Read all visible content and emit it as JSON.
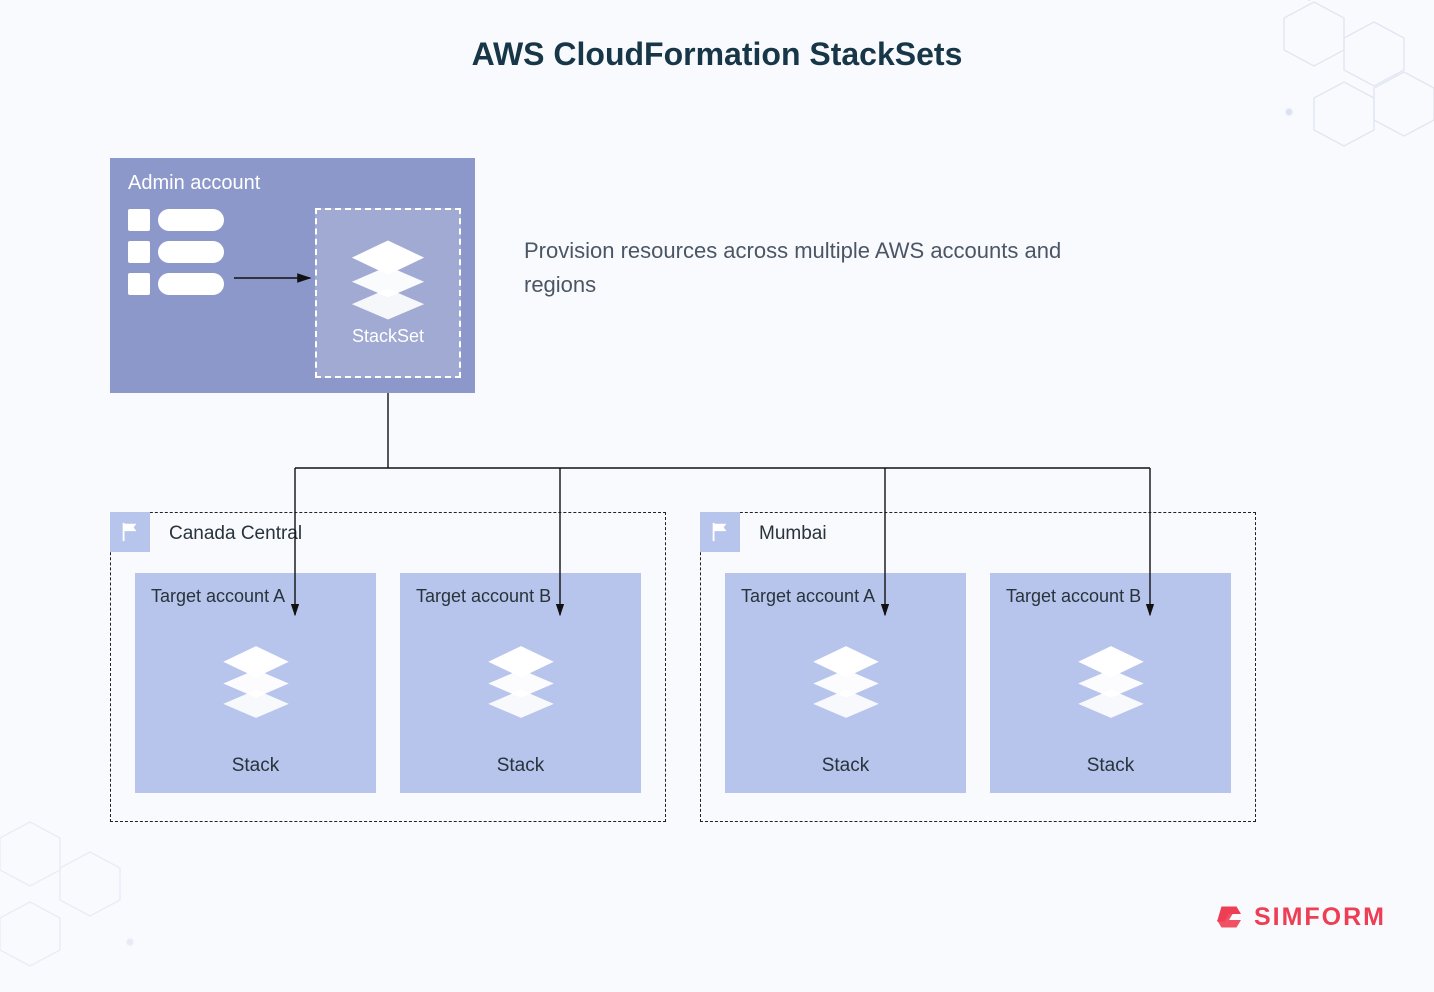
{
  "title": "AWS CloudFormation StackSets",
  "admin": {
    "title": "Admin account",
    "stackset_label": "StackSet"
  },
  "description": "Provision resources across multiple AWS accounts and regions",
  "regions": [
    {
      "name": "Canada Central",
      "targets": [
        {
          "label": "Target account A",
          "stack": "Stack"
        },
        {
          "label": "Target account B",
          "stack": "Stack"
        }
      ]
    },
    {
      "name": "Mumbai",
      "targets": [
        {
          "label": "Target account A",
          "stack": "Stack"
        },
        {
          "label": "Target account B",
          "stack": "Stack"
        }
      ]
    }
  ],
  "brand": "SIMFORM"
}
